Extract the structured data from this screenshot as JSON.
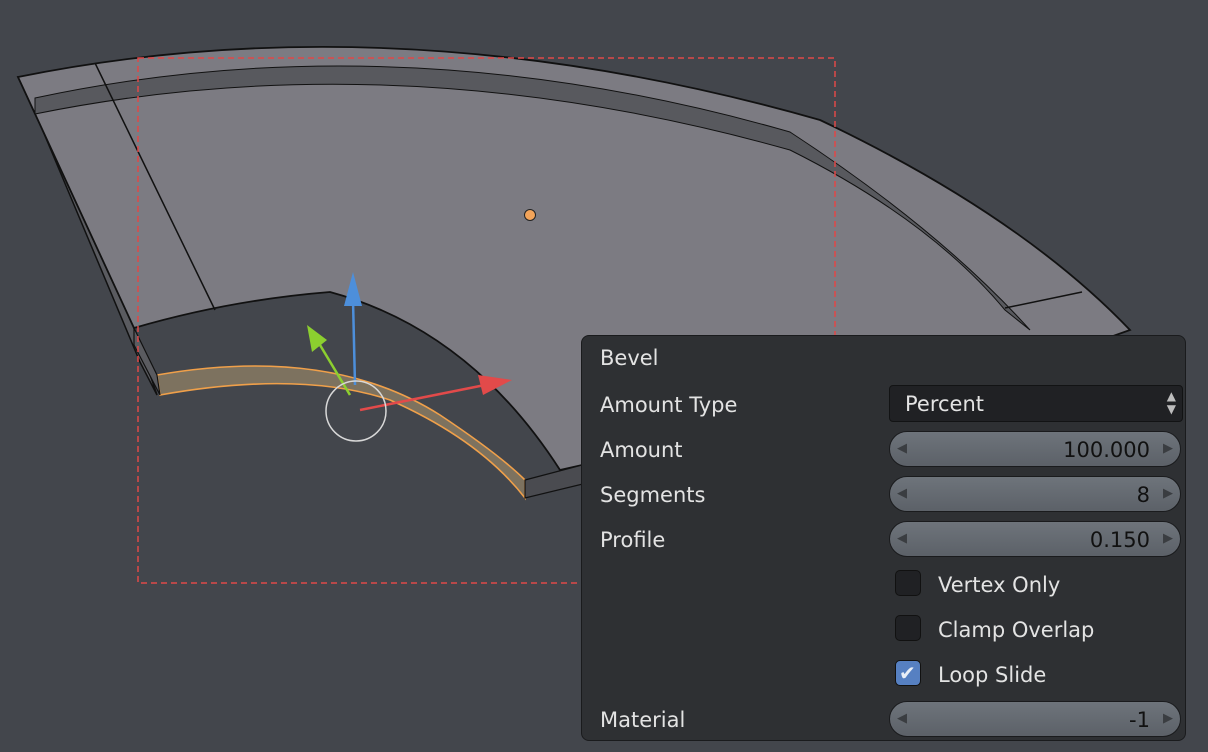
{
  "panel": {
    "title": "Bevel",
    "amount_type": {
      "label": "Amount Type",
      "value": "Percent"
    },
    "amount": {
      "label": "Amount",
      "value": "100.000"
    },
    "segments": {
      "label": "Segments",
      "value": "8"
    },
    "profile": {
      "label": "Profile",
      "value": "0.150"
    },
    "vertex_only": {
      "label": "Vertex Only",
      "checked": false
    },
    "clamp_overlap": {
      "label": "Clamp Overlap",
      "checked": false
    },
    "loop_slide": {
      "label": "Loop Slide",
      "checked": true
    },
    "material": {
      "label": "Material",
      "value": "-1"
    }
  },
  "colors": {
    "background": "#43464c",
    "mesh_face": "#7c7b82",
    "selection": "#f0a04a",
    "gizmo_x": "#e24a4a",
    "gizmo_y": "#8ccf2f",
    "gizmo_z": "#4d8fdb",
    "box_select": "#e04848",
    "checkbox_on": "#5680c2"
  }
}
